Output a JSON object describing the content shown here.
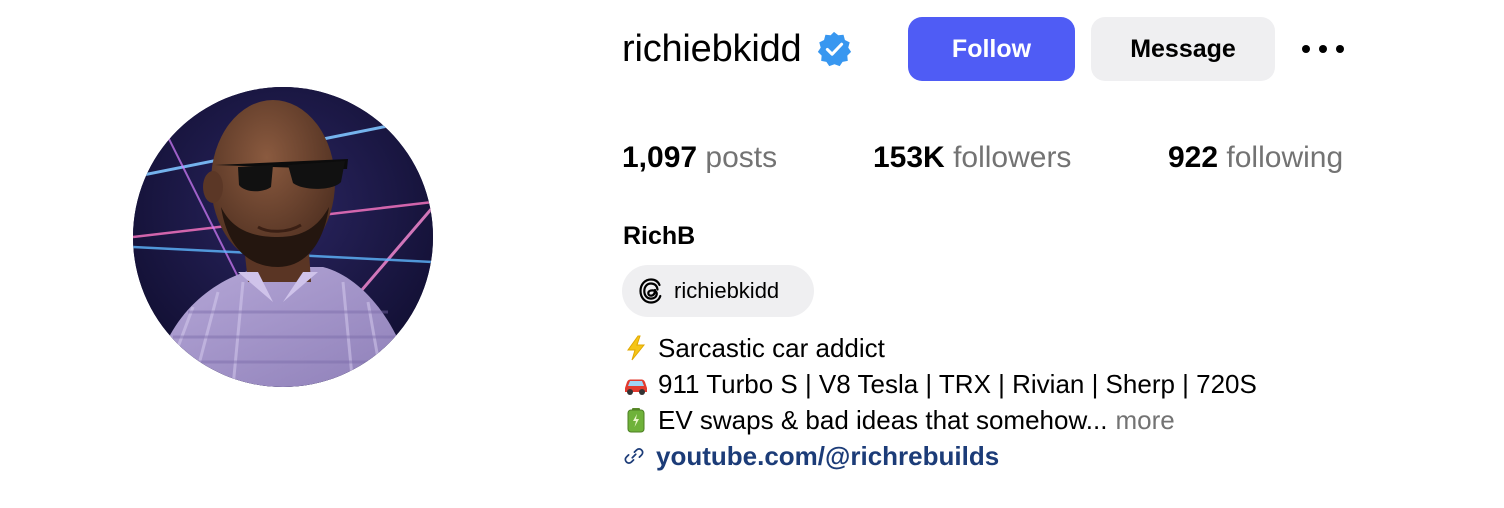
{
  "profile": {
    "username": "richiebkidd",
    "full_name": "RichB",
    "verified": true
  },
  "actions": {
    "follow_label": "Follow",
    "message_label": "Message",
    "more_icon": "more-horizontal-icon"
  },
  "stats": {
    "posts_count": "1,097",
    "posts_label": "posts",
    "followers_count": "153K",
    "followers_label": "followers",
    "following_count": "922",
    "following_label": "following"
  },
  "threads": {
    "icon": "threads-icon",
    "handle": "richiebkidd"
  },
  "bio": {
    "line1_icon": "lightning-emoji",
    "line1_text": "Sarcastic car addict",
    "line2_icon": "car-emoji",
    "line2_text": "911 Turbo S | V8 Tesla | TRX | Rivian | Sherp | 720S",
    "line3_icon": "battery-emoji",
    "line3_text": "EV swaps & bad ideas that somehow...",
    "more_label": "more",
    "link_icon": "link-icon",
    "link_text": "youtube.com/@richrebuilds"
  },
  "colors": {
    "follow_button": "#4f5cf5",
    "message_button": "#efeff1",
    "secondary_text": "#737373",
    "link_text": "#1c3c78",
    "verified_badge": "#3897f0"
  }
}
